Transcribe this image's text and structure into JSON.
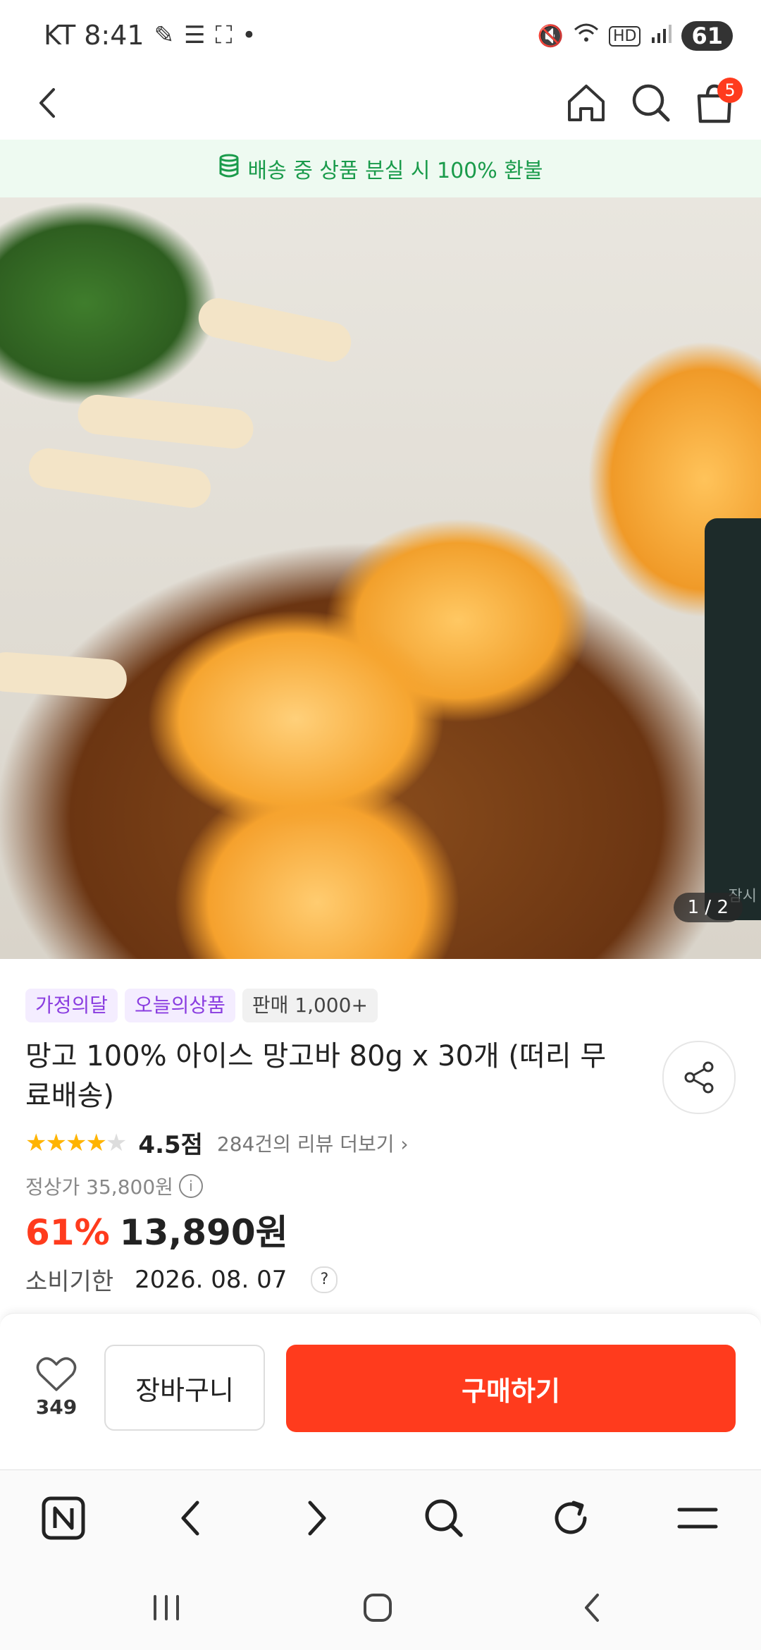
{
  "status_bar": {
    "carrier_time": "KT 8:41",
    "battery": "61"
  },
  "top_nav": {
    "cart_count": "5"
  },
  "banner": {
    "text": "배송 중 상품 분실 시 100% 환불"
  },
  "product_image": {
    "pager": "1 / 2",
    "next_thumb_text": "잠시"
  },
  "product": {
    "tags": [
      "가정의달",
      "오늘의상품",
      "판매 1,000+"
    ],
    "title": "망고 100% 아이스 망고바 80g x 30개 (떠리 무료배송)",
    "rating_score": "4.5점",
    "review_link": "284건의 리뷰 더보기",
    "original_price": "정상가 35,800원",
    "discount": "61%",
    "sale_price": "13,890원",
    "expiry_label": "소비기한",
    "expiry_date": "2026. 08. 07"
  },
  "bottom_bar": {
    "wish_count": "349",
    "cart_label": "장바구니",
    "buy_label": "구매하기"
  },
  "colors": {
    "accent": "#ff3b1d",
    "banner_bg": "#eefaf1",
    "banner_text": "#1a9b4b",
    "tag_purple": "#8a3de0"
  }
}
